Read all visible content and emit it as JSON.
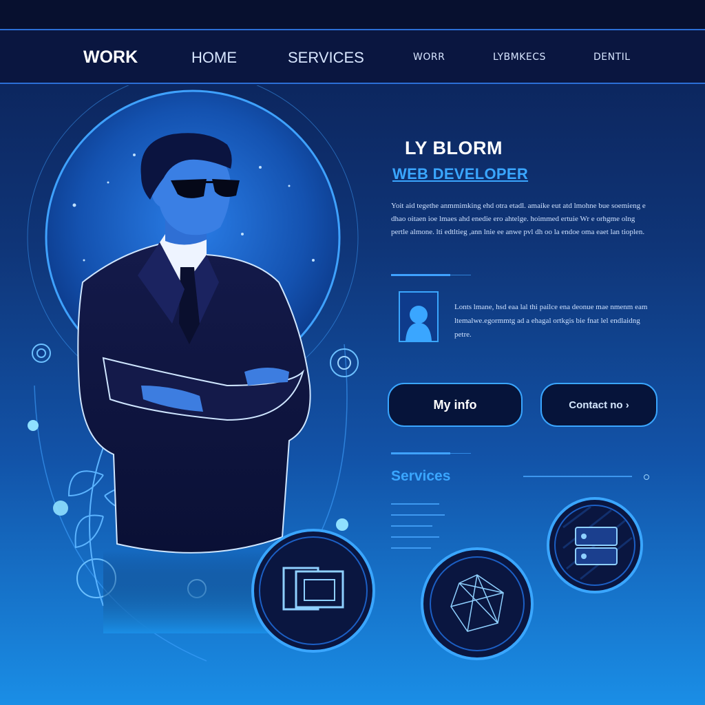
{
  "nav": {
    "items": [
      {
        "label": "WORK"
      },
      {
        "label": "HOME"
      },
      {
        "label": "SERVICES"
      },
      {
        "label": "WORR"
      },
      {
        "label": "LYBMKECS"
      },
      {
        "label": "DENTIL"
      }
    ]
  },
  "profile": {
    "name": "LY BLORM",
    "role": "WEB DEVELOPER",
    "bio": "Yoit aid tegethe anmmimking ehd otra etadl. amaike eut atd lmohne bue soemieng e dhao oitaen ioe lmaes ahd enedie ero ahtelge. hoimmed ertuie Wr e orhgme olng pertle almone. lti edtltieg ,ann lnie ee anwe pvl dh oo la endoe oma eaet lan tioplen."
  },
  "card": {
    "text": "Lonts lmane, hsd eaa lal thi pailce ena deonue mae nmenm eam ltemalwe.egormmtg ad a ehagal ortkgis bie fnat lel endlaidng petre."
  },
  "buttons": {
    "info_label": "My info",
    "contact_label": "Contact no ›"
  },
  "services": {
    "title": "Services"
  },
  "colors": {
    "accent": "#3aa6ff",
    "navbar": "#0a1640",
    "button_bg": "#06143a"
  }
}
